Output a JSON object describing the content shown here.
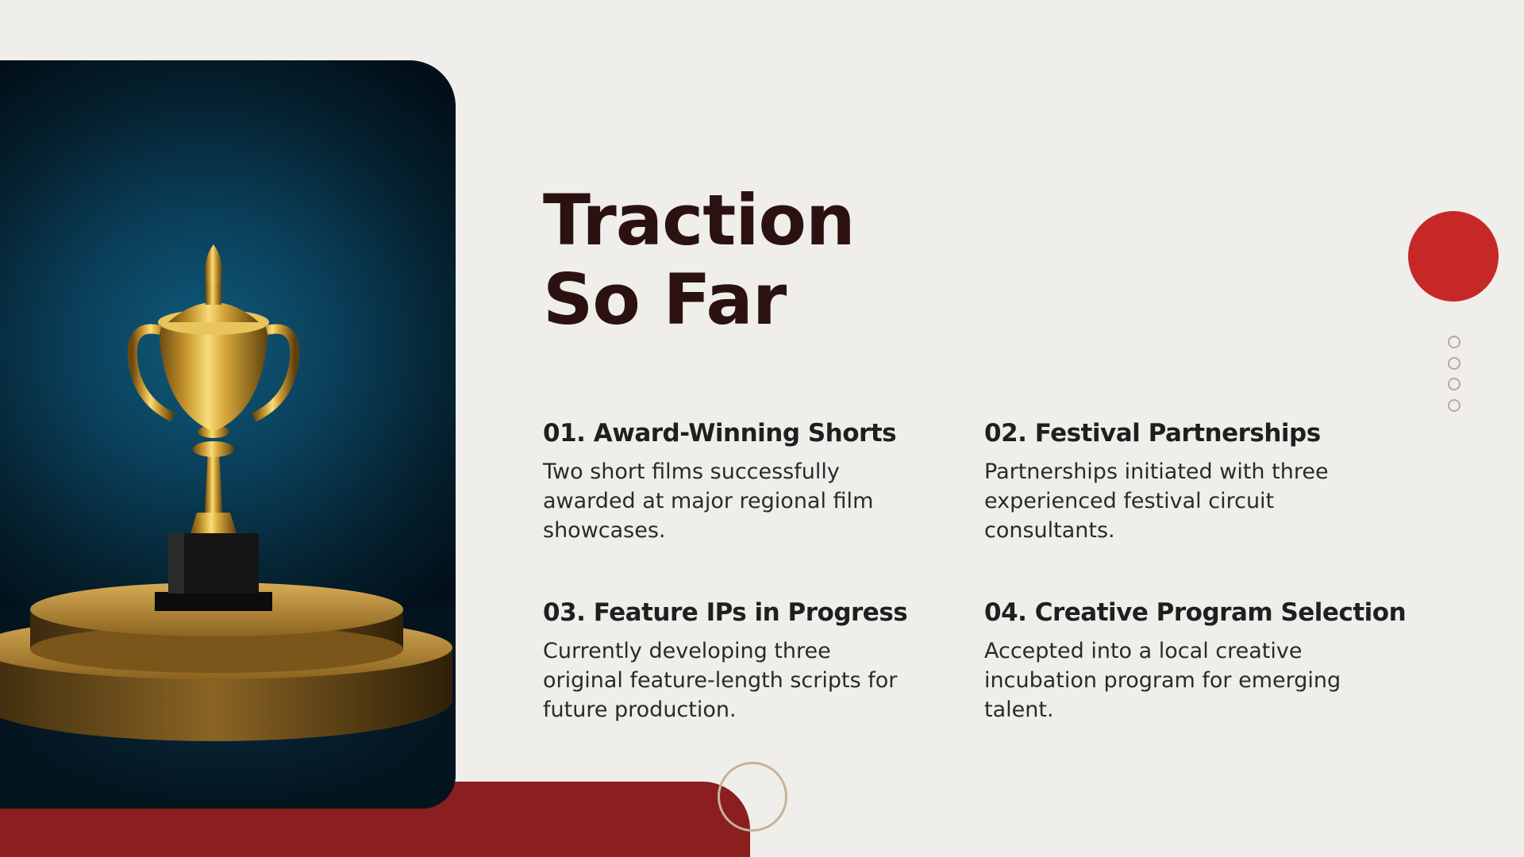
{
  "title": {
    "line1": "Traction",
    "line2": "So Far"
  },
  "items": [
    {
      "heading": "01. Award-Winning Shorts",
      "body": "Two short films successfully awarded at major regional film showcases."
    },
    {
      "heading": "02. Festival Partnerships",
      "body": "Partnerships initiated with three experienced festival circuit consultants."
    },
    {
      "heading": "03. Feature IPs in Progress",
      "body": "Currently developing three original feature-length scripts for future production."
    },
    {
      "heading": "04. Creative Program Selection",
      "body": "Accepted into a local creative incubation program for emerging talent."
    }
  ],
  "image": {
    "subject": "trophy-photo"
  },
  "colors": {
    "background": "#f0eeeb",
    "title": "#2b1211",
    "accent_red": "#c62828",
    "band_red": "#8b1e1e",
    "outline": "#c7b29b",
    "text": "#2a2a2a"
  }
}
